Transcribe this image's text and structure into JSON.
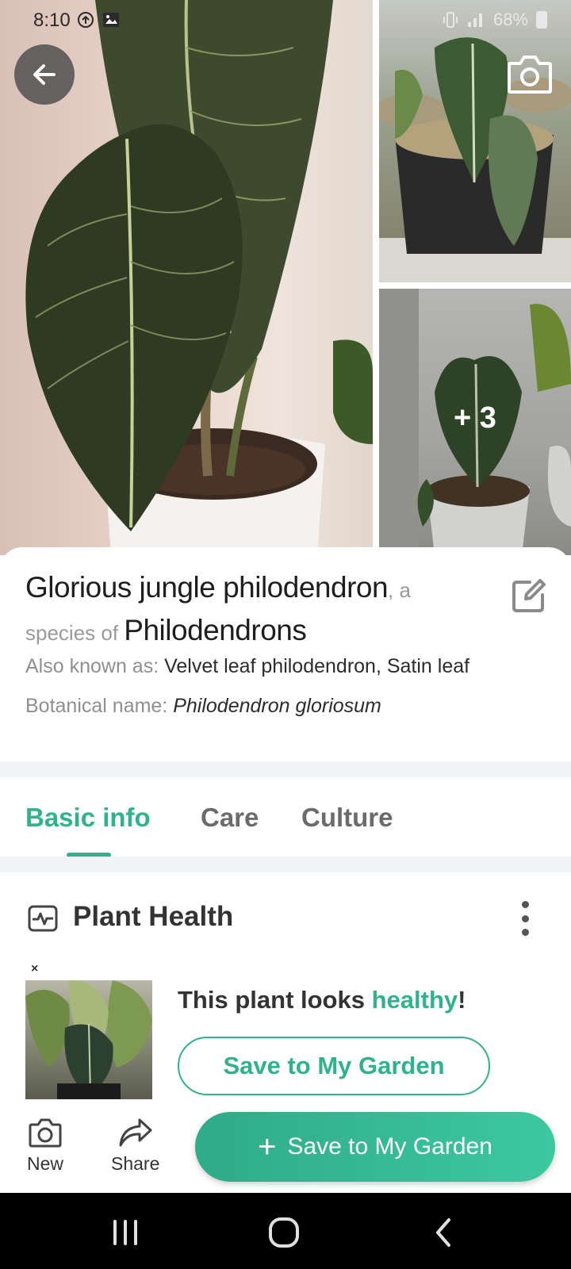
{
  "status_bar": {
    "time": "8:10",
    "battery": "68%",
    "left_icons": [
      "settings-sync-icon",
      "image-icon"
    ],
    "right_icons": [
      "vibrate-icon",
      "signal-icon",
      "battery-icon"
    ]
  },
  "gallery": {
    "more_photos_label": "+ 3",
    "icons": [
      "back-arrow-icon",
      "camera-icon"
    ]
  },
  "plant": {
    "common_name": "Glorious jungle philodendron",
    "species_connector": ", a species of ",
    "genus": "Philodendrons",
    "also_known_label": "Also known as: ",
    "also_known_value": "Velvet leaf philodendron, Satin leaf",
    "botanical_label": "Botanical name: ",
    "botanical_value": "Philodendron gloriosum"
  },
  "tabs": [
    {
      "label": "Basic info",
      "active": true
    },
    {
      "label": "Care",
      "active": false
    },
    {
      "label": "Culture",
      "active": false
    }
  ],
  "health": {
    "title": "Plant Health",
    "close_label": "×",
    "message_prefix": "This plant looks ",
    "message_status": "healthy",
    "message_suffix": "!",
    "save_button": "Save to My Garden"
  },
  "action_bar": {
    "new_label": "New",
    "share_label": "Share",
    "save_label": "Save to My Garden",
    "save_icon": "+"
  },
  "colors": {
    "accent": "#2fb38d",
    "text_primary": "#1e1e1e",
    "text_muted": "#8f8f8f"
  }
}
